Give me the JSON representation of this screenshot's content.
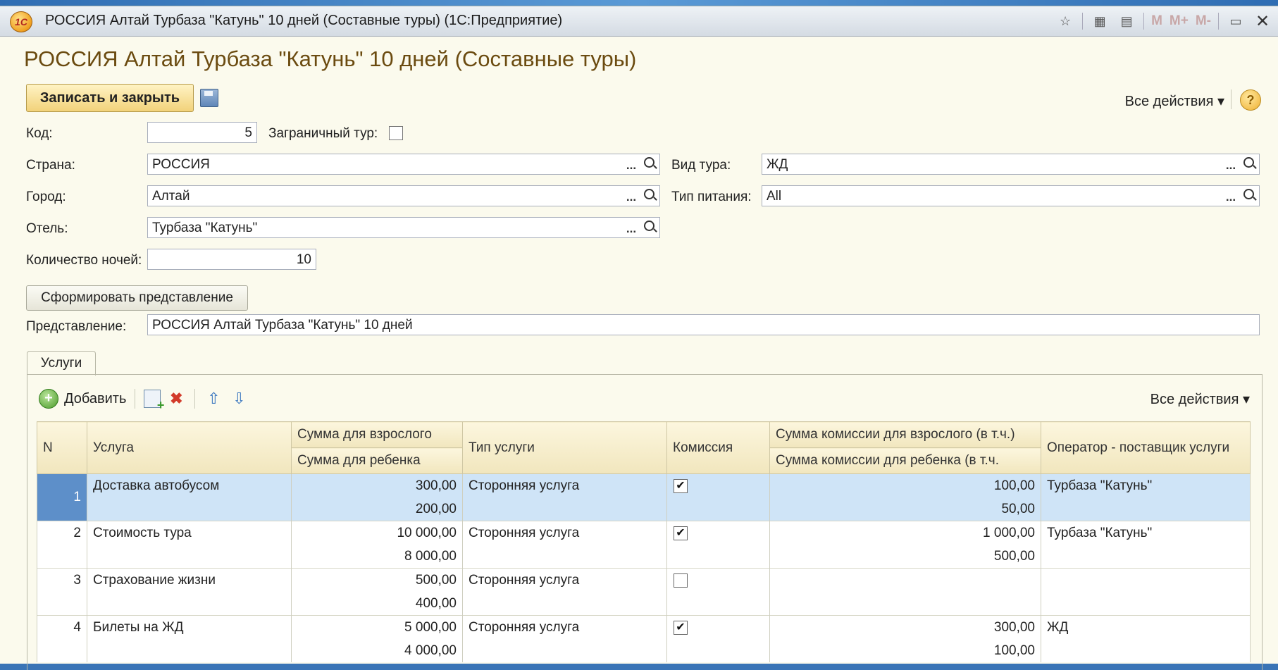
{
  "window": {
    "title": "РОССИЯ Алтай Турбаза \"Катунь\" 10 дней (Составные туры)  (1С:Предприятие)",
    "logo_text": "1С",
    "toolbar_icons": [
      "favorite-icon",
      "calculator-icon",
      "calendar-icon"
    ],
    "memory_buttons": [
      "M",
      "M+",
      "M-"
    ],
    "icons": [
      "restore-icon",
      "close-icon"
    ]
  },
  "form": {
    "title": "РОССИЯ Алтай Турбаза \"Катунь\" 10 дней (Составные туры)",
    "save_close_button": "Записать и закрыть",
    "all_actions": "Все действия ▾",
    "help_icon": "?"
  },
  "fields": {
    "code_label": "Код:",
    "code_value": "5",
    "foreign_tour_label": "Заграничный тур:",
    "foreign_tour_checked": false,
    "country_label": "Страна:",
    "country_value": "РОССИЯ",
    "tour_type_label": "Вид тура:",
    "tour_type_value": "ЖД",
    "city_label": "Город:",
    "city_value": "Алтай",
    "meal_type_label": "Тип питания:",
    "meal_type_value": "All",
    "hotel_label": "Отель:",
    "hotel_value": "Турбаза \"Катунь\"",
    "nights_label": "Количество ночей:",
    "nights_value": "10",
    "select_button": "...",
    "generate_button": "Сформировать представление",
    "presentation_label": "Представление:",
    "presentation_value": "РОССИЯ Алтай Турбаза \"Катунь\" 10 дней"
  },
  "tabs": [
    {
      "label": "Услуги",
      "active": true
    }
  ],
  "services_toolbar": {
    "add_label": "Добавить",
    "all_actions": "Все действия ▾",
    "icons": [
      "add-icon",
      "copy-icon",
      "delete-icon",
      "move-up-icon",
      "move-down-icon"
    ]
  },
  "table": {
    "headers": {
      "n": "N",
      "service": "Услуга",
      "adult_sum": "Сумма для взрослого",
      "child_sum": "Сумма для ребенка",
      "service_type": "Тип услуги",
      "commission": "Комиссия",
      "adult_commission": "Сумма комиссии для взрослого (в т.ч.)",
      "child_commission": "Сумма комиссии для ребенка (в т.ч.",
      "operator": "Оператор - поставщик услуги"
    },
    "rows": [
      {
        "n": "1",
        "service": "Доставка автобусом",
        "adult_sum": "300,00",
        "child_sum": "200,00",
        "service_type": "Сторонняя услуга",
        "commission": true,
        "adult_commission": "100,00",
        "child_commission": "50,00",
        "operator": "Турбаза \"Катунь\"",
        "selected": true
      },
      {
        "n": "2",
        "service": "Стоимость тура",
        "adult_sum": "10 000,00",
        "child_sum": "8 000,00",
        "service_type": "Сторонняя услуга",
        "commission": true,
        "adult_commission": "1 000,00",
        "child_commission": "500,00",
        "operator": "Турбаза \"Катунь\"",
        "selected": false
      },
      {
        "n": "3",
        "service": "Страхование жизни",
        "adult_sum": "500,00",
        "child_sum": "400,00",
        "service_type": "Сторонняя услуга",
        "commission": false,
        "adult_commission": "",
        "child_commission": "",
        "operator": "",
        "selected": false
      },
      {
        "n": "4",
        "service": "Билеты на ЖД",
        "adult_sum": "5 000,00",
        "child_sum": "4 000,00",
        "service_type": "Сторонняя услуга",
        "commission": true,
        "adult_commission": "300,00",
        "child_commission": "100,00",
        "operator": "ЖД",
        "selected": false
      }
    ]
  }
}
